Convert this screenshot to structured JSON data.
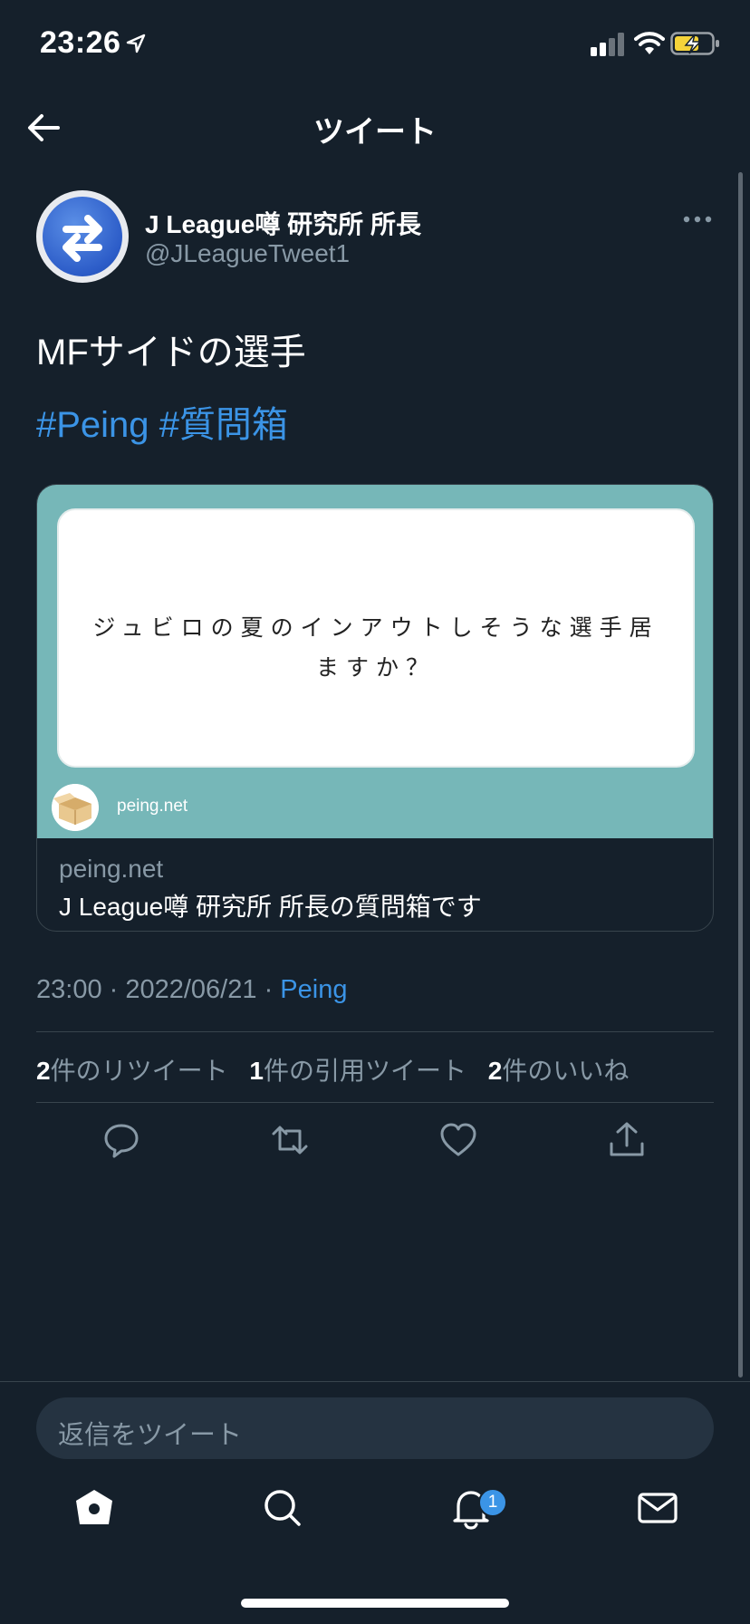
{
  "status_bar": {
    "time": "23:26"
  },
  "header": {
    "title": "ツイート"
  },
  "tweet": {
    "author_name": "J League噂 研究所 所長",
    "author_handle": "@JLeagueTweet1",
    "text": "MFサイドの選手",
    "hashtags": [
      "#Peing",
      "#質問箱"
    ],
    "card": {
      "question": "ジュビロの夏のインアウトしそうな選手居ますか？",
      "logo_text": "peing.net",
      "domain": "peing.net",
      "title": "J League噂 研究所 所長の質問箱です"
    },
    "time": "23:00",
    "date": "2022/06/21",
    "source": "Peing",
    "separator": " · ",
    "stats": {
      "retweets_count": "2",
      "retweets_label": "件のリツイート",
      "quotes_count": "1",
      "quotes_label": "件の引用ツイート",
      "likes_count": "2",
      "likes_label": "件のいいね"
    }
  },
  "reply": {
    "placeholder": "返信をツイート"
  },
  "tabbar": {
    "notification_badge": "1"
  },
  "colors": {
    "background": "#15202b",
    "accent": "#3b94e6",
    "card_teal": "#76b7b8",
    "muted": "#8899a6"
  }
}
